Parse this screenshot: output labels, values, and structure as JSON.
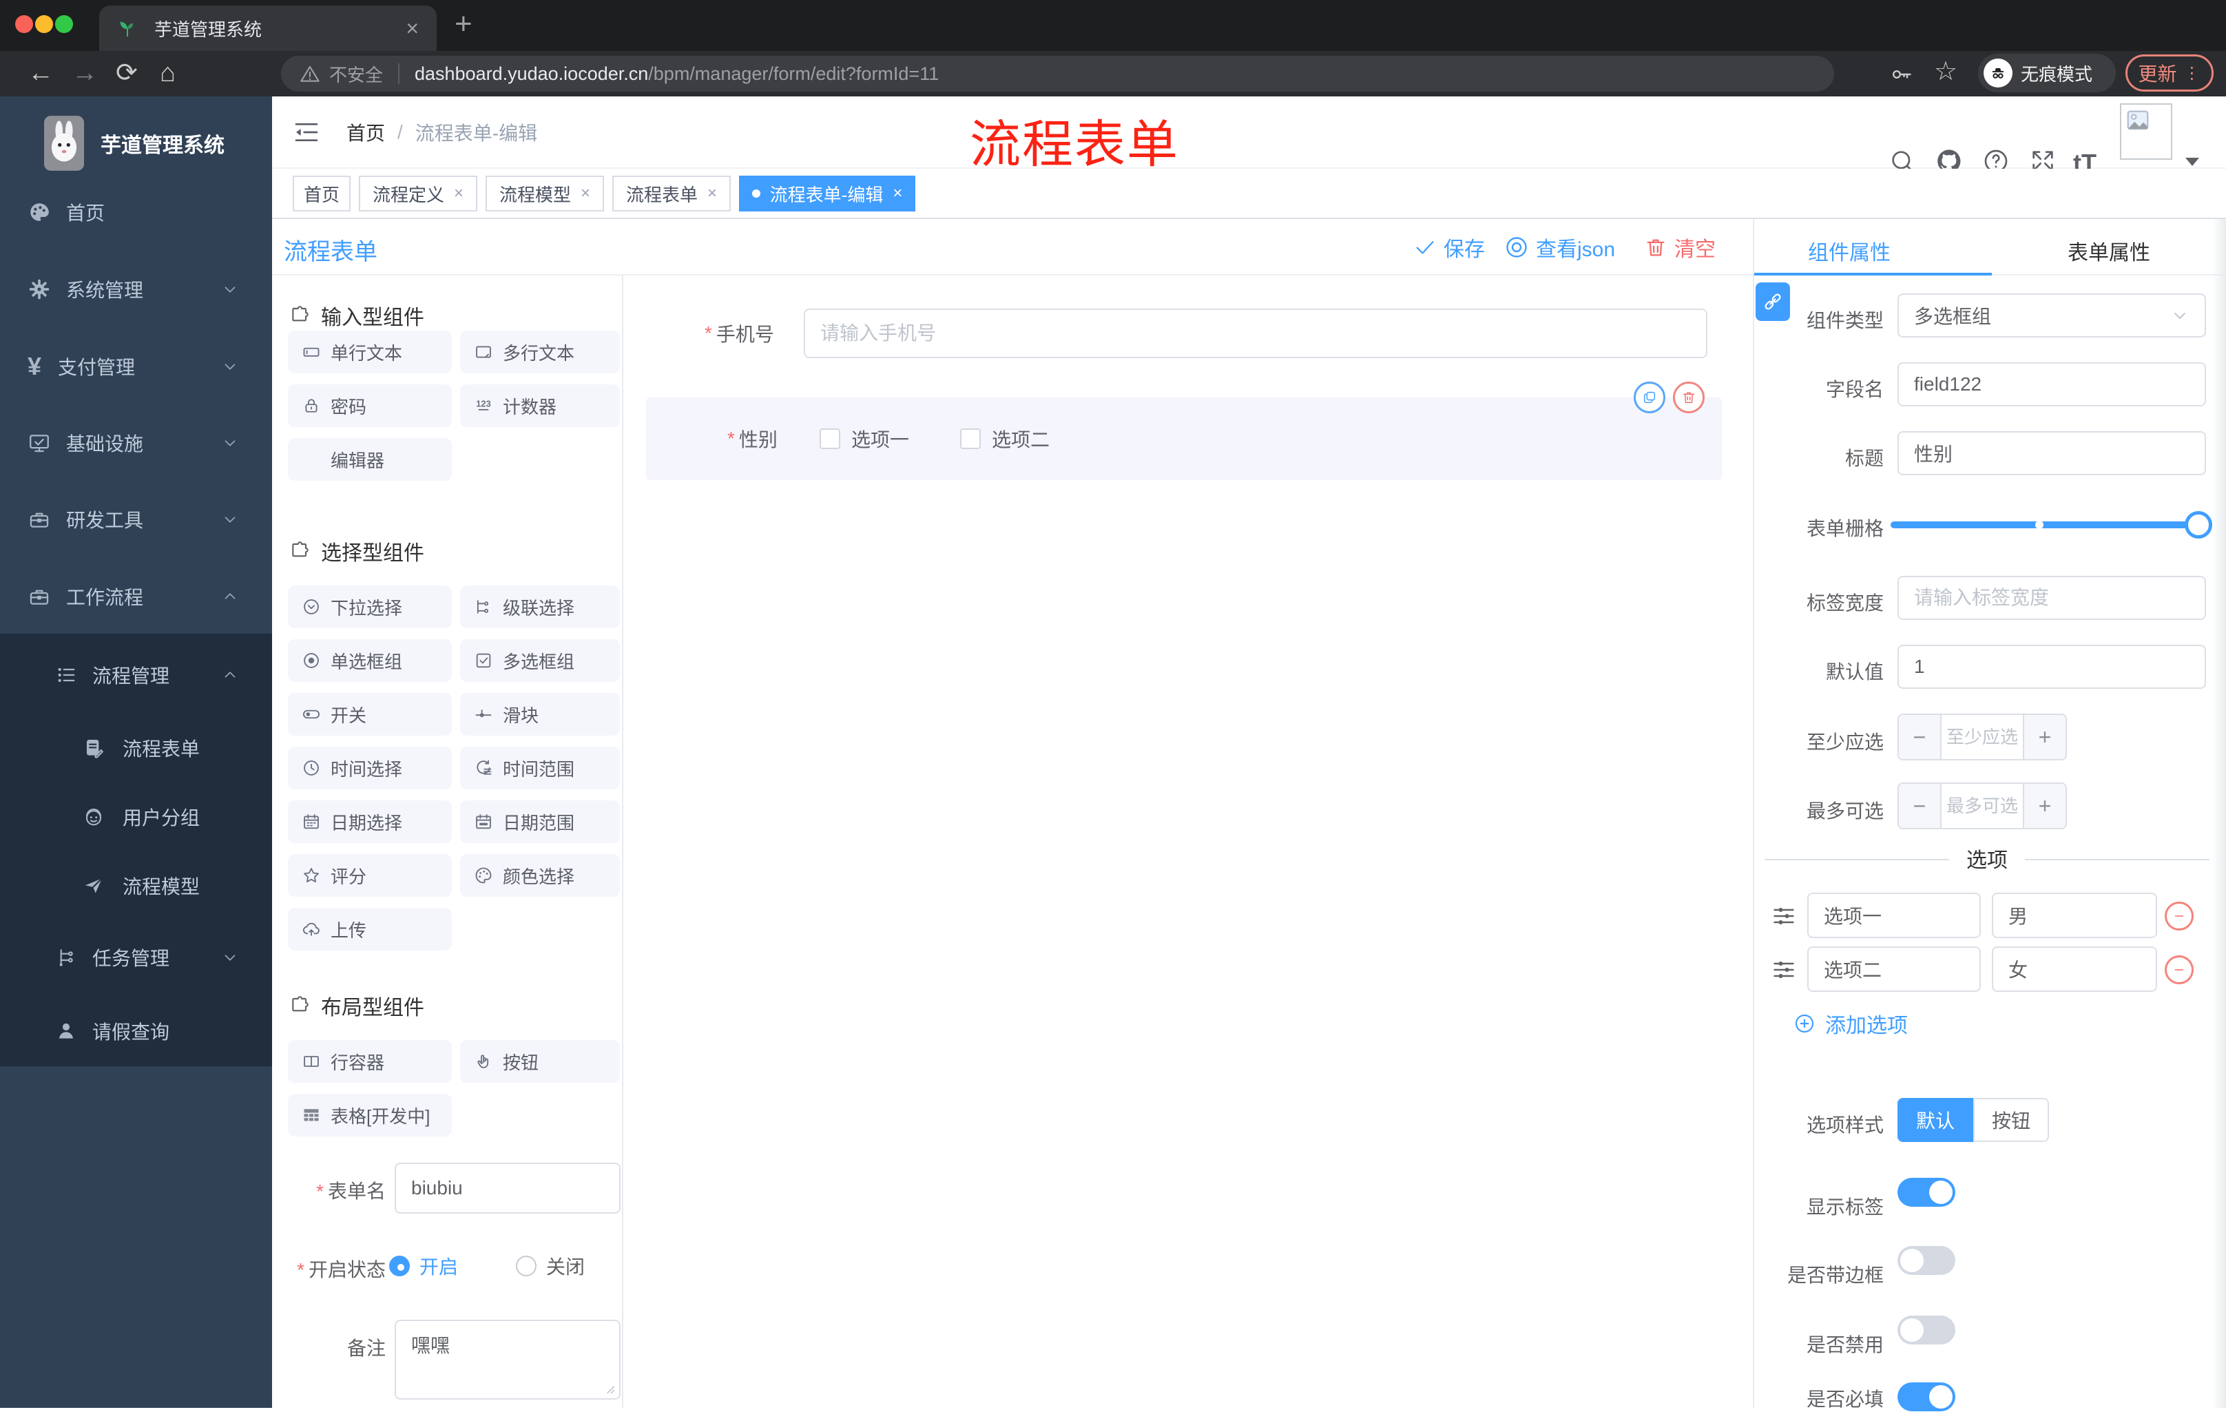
{
  "colors": {
    "accent": "#409eff",
    "danger": "#f56c6c",
    "sidebar_bg": "#304156",
    "submenu_bg": "#1f2d3d",
    "annotation": "#fa2314"
  },
  "browser": {
    "tab_title": "芋道管理系统",
    "new_tab": "+",
    "close": "×",
    "security_label": "不安全",
    "url_host": "dashboard.yudao.iocoder.cn",
    "url_path": "/bpm/manager/form/edit?formId=11",
    "incognito_label": "无痕模式",
    "update_label": "更新"
  },
  "sidebar": {
    "logo_title": "芋道管理系统",
    "items": [
      {
        "label": "首页"
      },
      {
        "label": "系统管理"
      },
      {
        "label": "支付管理"
      },
      {
        "label": "基础设施"
      },
      {
        "label": "研发工具"
      },
      {
        "label": "工作流程"
      },
      {
        "label": "流程管理"
      },
      {
        "label": "流程表单"
      },
      {
        "label": "用户分组"
      },
      {
        "label": "流程模型"
      },
      {
        "label": "任务管理"
      },
      {
        "label": "请假查询"
      }
    ]
  },
  "header": {
    "breadcrumb_home": "首页",
    "breadcrumb_sep": "/",
    "breadcrumb_current": "流程表单-编辑"
  },
  "annotation": {
    "text": "流程表单"
  },
  "tabs": [
    {
      "label": "首页"
    },
    {
      "label": "流程定义"
    },
    {
      "label": "流程模型"
    },
    {
      "label": "流程表单"
    },
    {
      "label": "流程表单-编辑"
    }
  ],
  "designer": {
    "title": "流程表单",
    "save": "保存",
    "view_json": "查看json",
    "clear": "清空"
  },
  "components": {
    "groups": [
      {
        "title": "输入型组件",
        "items": [
          {
            "label": "单行文本",
            "icon": "input-icon"
          },
          {
            "label": "多行文本",
            "icon": "textarea-icon"
          },
          {
            "label": "密码",
            "icon": "lock-icon"
          },
          {
            "label": "计数器",
            "icon": "counter-icon"
          },
          {
            "label": "编辑器",
            "icon": "none"
          }
        ]
      },
      {
        "title": "选择型组件",
        "items": [
          {
            "label": "下拉选择",
            "icon": "select-icon"
          },
          {
            "label": "级联选择",
            "icon": "cascader-icon"
          },
          {
            "label": "单选框组",
            "icon": "radio-icon"
          },
          {
            "label": "多选框组",
            "icon": "checkbox-icon"
          },
          {
            "label": "开关",
            "icon": "switch-icon"
          },
          {
            "label": "滑块",
            "icon": "slider-icon"
          },
          {
            "label": "时间选择",
            "icon": "time-icon"
          },
          {
            "label": "时间范围",
            "icon": "time-range-icon"
          },
          {
            "label": "日期选择",
            "icon": "date-icon"
          },
          {
            "label": "日期范围",
            "icon": "date-range-icon"
          },
          {
            "label": "评分",
            "icon": "rate-icon"
          },
          {
            "label": "颜色选择",
            "icon": "color-icon"
          },
          {
            "label": "上传",
            "icon": "upload-icon"
          }
        ]
      },
      {
        "title": "布局型组件",
        "items": [
          {
            "label": "行容器",
            "icon": "row-container-icon"
          },
          {
            "label": "按钮",
            "icon": "button-icon"
          },
          {
            "label": "表格[开发中]",
            "icon": "table-icon"
          }
        ]
      }
    ]
  },
  "left_form": {
    "name_label": "表单名",
    "name_value": "biubiu",
    "status_label": "开启状态",
    "status_on": "开启",
    "status_off": "关闭",
    "remark_label": "备注",
    "remark_value": "嘿嘿"
  },
  "canvas": {
    "phone_label": "手机号",
    "phone_placeholder": "请输入手机号",
    "gender_label": "性别",
    "gender_options": [
      {
        "label": "选项一"
      },
      {
        "label": "选项二"
      }
    ]
  },
  "props": {
    "tab_component": "组件属性",
    "tab_form": "表单属性",
    "type_label": "组件类型",
    "type_value": "多选框组",
    "field_label": "字段名",
    "field_value": "field122",
    "title_label": "标题",
    "title_value": "性别",
    "grid_label": "表单栅格",
    "width_label": "标签宽度",
    "width_placeholder": "请输入标签宽度",
    "default_label": "默认值",
    "default_value": "1",
    "min_label": "至少应选",
    "min_placeholder": "至少应选",
    "max_label": "最多可选",
    "max_placeholder": "最多可选",
    "options_title": "选项",
    "options": [
      {
        "label": "选项一",
        "value": "男"
      },
      {
        "label": "选项二",
        "value": "女"
      }
    ],
    "add_option": "添加选项",
    "style_label": "选项样式",
    "style_default": "默认",
    "style_button": "按钮",
    "toggles": [
      {
        "label": "显示标签",
        "on": true
      },
      {
        "label": "是否带边框",
        "on": false
      },
      {
        "label": "是否禁用",
        "on": false
      },
      {
        "label": "是否必填",
        "on": true
      }
    ]
  }
}
